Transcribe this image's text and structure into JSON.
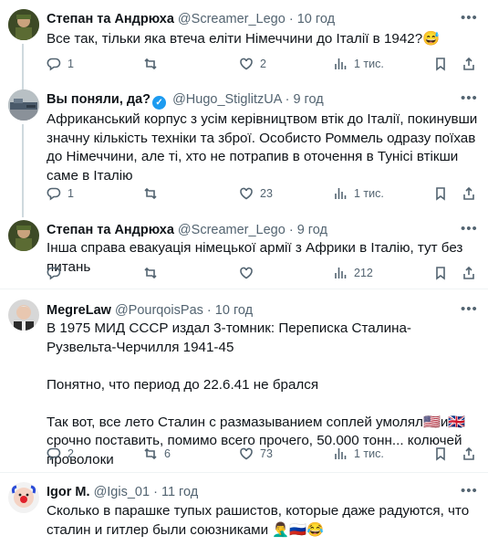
{
  "colors": {
    "text": "#0f1419",
    "secondary": "#536471",
    "divider": "#eff3f4",
    "verified": "#1d9bf0"
  },
  "tweets": [
    {
      "name": "Степан та Андрюха",
      "handle": "@Screamer_Lego",
      "dot": "·",
      "time": "10 год",
      "text": "Все так, тільки яка втеча еліти Німеччини до Італії в 1942?😅",
      "replies": "1",
      "retweets": "",
      "likes": "2",
      "views": "1 тис."
    },
    {
      "name": "Вы поняли, да?",
      "verified": "✓",
      "handle": "@Hugo_StiglitzUA",
      "dot": "·",
      "time": "9 год",
      "text": "Африканський корпус з усім керівництвом втік до Італії, покинувши значну кількість техніки та зброї. Особисто Роммель одразу поїхав до Німеччини, але ті, хто не потрапив в оточення в Тунісі втікши саме в Італію",
      "replies": "1",
      "retweets": "",
      "likes": "23",
      "views": "1 тис."
    },
    {
      "name": "Степан та Андрюха",
      "handle": "@Screamer_Lego",
      "dot": "·",
      "time": "9 год",
      "text": "Інша справа евакуація німецької армії з Африки в Італію, тут без питань",
      "replies": "",
      "retweets": "",
      "likes": "",
      "views": "212"
    },
    {
      "name": "MegreLaw",
      "handle": "@PourqoisPas",
      "dot": "·",
      "time": "10 год",
      "text": "В 1975 МИД СССР издал 3-томник: Переписка Сталина-Рузвельта-Черчилля 1941-45\n\nПонятно, что период до 22.6.41 не брался\n\nТак вот, все лето Сталин с размазыванием соплей умолял🇺🇸и🇬🇧срочно поставить, помимо всего прочего, 50.000 тонн... колючей проволоки",
      "replies": "2",
      "retweets": "6",
      "likes": "73",
      "views": "1 тис."
    },
    {
      "name": "Igor M.",
      "handle": "@Igis_01",
      "dot": "·",
      "time": "11 год",
      "text": "Сколько в парашке тупых рашистов, которые даже радуются, что сталин и гитлер были союзниками 🤦‍♂️🇷🇺😂",
      "replies": "",
      "retweets": "",
      "likes": "",
      "views": ""
    }
  ],
  "icons": {
    "reply": "reply-icon",
    "retweet": "retweet-icon",
    "like": "heart-icon",
    "views": "views-chart-icon",
    "bookmark": "bookmark-icon",
    "share": "share-icon",
    "more": "more-dots-icon"
  }
}
